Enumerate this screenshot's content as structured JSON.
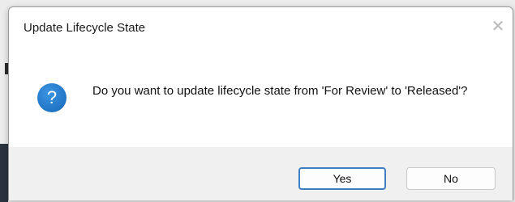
{
  "dialog": {
    "title": "Update Lifecycle State",
    "close_glyph": "✕",
    "message": "Do you want to update lifecycle state from 'For Review' to 'Released'?",
    "icon": "question-icon",
    "icon_glyph": "?",
    "buttons": {
      "yes_label": "Yes",
      "no_label": "No"
    }
  },
  "colors": {
    "icon_blue": "#1a73c9",
    "default_button_border": "#3f7fbf",
    "footer_bg": "#f0f0f0"
  }
}
